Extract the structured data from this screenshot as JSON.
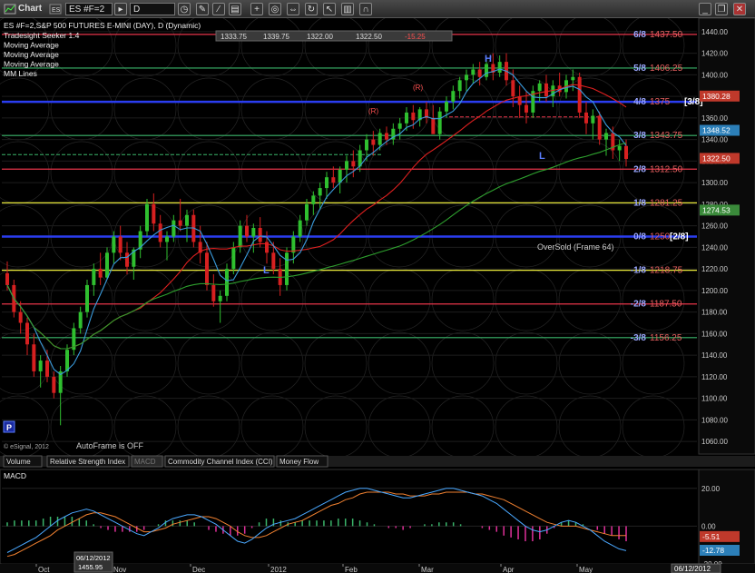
{
  "window": {
    "title": "Chart",
    "symbol": "ES #F=2",
    "interval": "D",
    "controls": [
      "minimize",
      "restore",
      "close"
    ]
  },
  "legend": {
    "line1": "ES #F=2,S&P 500 FUTURES E-MINI (DAY), D (Dynamic)",
    "indicators": [
      "Tradesight Seeker 1.4",
      "Moving Average",
      "Moving Average",
      "Moving Average",
      "MM Lines"
    ],
    "ohlc": [
      "1333.75",
      "1339.75",
      "1322.00",
      "1322.50",
      "-15.25"
    ]
  },
  "mm_lines": [
    {
      "label": "6/8",
      "value": "1437.50",
      "price": 1437.5,
      "color": "#e8344a"
    },
    {
      "label": "5/8",
      "value": "1406.25",
      "price": 1406.25,
      "color": "#3ab56a"
    },
    {
      "label": "4/8",
      "value": "1375",
      "price": 1375,
      "color": "#2a3df0"
    },
    {
      "label": "3/8",
      "value": "1343.75",
      "price": 1343.75,
      "color": "#3ab56a"
    },
    {
      "label": "2/8",
      "value": "1312.50",
      "price": 1312.5,
      "color": "#e8344a"
    },
    {
      "label": "1/8",
      "value": "1281.25",
      "price": 1281.25,
      "color": "#e8e83a"
    },
    {
      "label": "0/8",
      "value": "1250",
      "price": 1250,
      "color": "#2a3df0"
    },
    {
      "label": "-1/8",
      "value": "1218.75",
      "price": 1218.75,
      "color": "#e8e83a"
    },
    {
      "label": "-2/8",
      "value": "1187.50",
      "price": 1187.5,
      "color": "#e8344a"
    },
    {
      "label": "-3/8",
      "value": "1156.25",
      "price": 1156.25,
      "color": "#3ab56a"
    }
  ],
  "mm_tags": {
    "four_eighths": "[3/8]",
    "zero_eighths": "[2/8]"
  },
  "price_badges": [
    {
      "value": "1380.28",
      "price": 1380.28,
      "color": "#c0392b"
    },
    {
      "value": "1348.52",
      "price": 1348.52,
      "color": "#2c7fb8"
    },
    {
      "value": "1322.50",
      "price": 1322.5,
      "color": "#c0392b"
    },
    {
      "value": "1274.53",
      "price": 1274.53,
      "color": "#3a8a3a"
    }
  ],
  "annotations": {
    "oversold": "OverSold (Frame 64)",
    "autoframe": "AutoFrame is OFF",
    "copyright": "© eSignal, 2012",
    "H": "H",
    "L1": "L",
    "L2": "L",
    "R1": "(R)",
    "R2": "(R)",
    "P": "P"
  },
  "x_axis": {
    "ticks": [
      "Oct",
      "Nov",
      "Dec",
      "2012",
      "Feb",
      "Mar",
      "Apr",
      "May"
    ],
    "cursor_date": "06/12/2012",
    "cursor_price": "1455.95",
    "end_date": "06/12/2012"
  },
  "tabs": [
    "Volume",
    "Relative Strength Index",
    "MACD",
    "Commodity Channel Index (CCI)",
    "Money Flow"
  ],
  "macd_panel": {
    "title": "MACD",
    "badges": [
      {
        "value": "-5.51",
        "color": "#c0392b"
      },
      {
        "value": "-12.78",
        "color": "#2c7fb8"
      }
    ]
  },
  "chart_data": [
    {
      "type": "candlestick",
      "title": "ES #F=2,S&P 500 FUTURES E-MINI (DAY), D (Dynamic)",
      "y_axis": {
        "ylim": [
          1050,
          1450
        ],
        "ticks": [
          1060,
          1080,
          1100,
          1120,
          1140,
          1160,
          1180,
          1200,
          1220,
          1240,
          1260,
          1280,
          1300,
          1320,
          1340,
          1360,
          1380,
          1400,
          1420,
          1440
        ],
        "side": "right"
      },
      "x_axis": {
        "ticks": [
          "Oct",
          "Nov",
          "Dec",
          "2012",
          "Feb",
          "Mar",
          "Apr",
          "May"
        ]
      },
      "last_close": 1322.5,
      "ohlc": [
        [
          1216,
          1227,
          1200,
          1205
        ],
        [
          1205,
          1210,
          1175,
          1180
        ],
        [
          1180,
          1190,
          1160,
          1170
        ],
        [
          1170,
          1175,
          1140,
          1150
        ],
        [
          1150,
          1160,
          1120,
          1125
        ],
        [
          1125,
          1140,
          1110,
          1135
        ],
        [
          1135,
          1145,
          1115,
          1120
        ],
        [
          1120,
          1125,
          1100,
          1105
        ],
        [
          1105,
          1130,
          1075,
          1125
        ],
        [
          1125,
          1150,
          1120,
          1145
        ],
        [
          1145,
          1170,
          1140,
          1165
        ],
        [
          1165,
          1185,
          1160,
          1180
        ],
        [
          1180,
          1210,
          1175,
          1205
        ],
        [
          1205,
          1225,
          1195,
          1220
        ],
        [
          1220,
          1235,
          1205,
          1212
        ],
        [
          1212,
          1240,
          1210,
          1235
        ],
        [
          1235,
          1255,
          1225,
          1250
        ],
        [
          1250,
          1260,
          1228,
          1235
        ],
        [
          1235,
          1245,
          1215,
          1222
        ],
        [
          1222,
          1240,
          1210,
          1238
        ],
        [
          1238,
          1260,
          1230,
          1255
        ],
        [
          1255,
          1285,
          1250,
          1280
        ],
        [
          1280,
          1290,
          1255,
          1262
        ],
        [
          1262,
          1270,
          1240,
          1245
        ],
        [
          1245,
          1255,
          1228,
          1250
        ],
        [
          1250,
          1270,
          1245,
          1265
        ],
        [
          1265,
          1285,
          1255,
          1260
        ],
        [
          1260,
          1275,
          1245,
          1270
        ],
        [
          1270,
          1275,
          1240,
          1245
        ],
        [
          1245,
          1260,
          1225,
          1235
        ],
        [
          1235,
          1245,
          1200,
          1205
        ],
        [
          1205,
          1215,
          1185,
          1190
        ],
        [
          1190,
          1200,
          1170,
          1195
        ],
        [
          1195,
          1225,
          1190,
          1220
        ],
        [
          1220,
          1245,
          1215,
          1240
        ],
        [
          1240,
          1265,
          1235,
          1260
        ],
        [
          1260,
          1270,
          1245,
          1250
        ],
        [
          1250,
          1262,
          1235,
          1258
        ],
        [
          1258,
          1268,
          1240,
          1245
        ],
        [
          1245,
          1255,
          1225,
          1235
        ],
        [
          1235,
          1245,
          1215,
          1220
        ],
        [
          1220,
          1230,
          1195,
          1205
        ],
        [
          1205,
          1240,
          1200,
          1235
        ],
        [
          1235,
          1255,
          1225,
          1250
        ],
        [
          1250,
          1270,
          1245,
          1265
        ],
        [
          1265,
          1285,
          1260,
          1280
        ],
        [
          1280,
          1292,
          1270,
          1288
        ],
        [
          1288,
          1300,
          1275,
          1295
        ],
        [
          1295,
          1310,
          1285,
          1305
        ],
        [
          1305,
          1315,
          1295,
          1300
        ],
        [
          1300,
          1315,
          1290,
          1312
        ],
        [
          1312,
          1325,
          1300,
          1320
        ],
        [
          1320,
          1330,
          1305,
          1315
        ],
        [
          1315,
          1335,
          1310,
          1330
        ],
        [
          1330,
          1345,
          1320,
          1340
        ],
        [
          1340,
          1348,
          1325,
          1335
        ],
        [
          1335,
          1350,
          1330,
          1346
        ],
        [
          1346,
          1352,
          1335,
          1340
        ],
        [
          1340,
          1355,
          1335,
          1350
        ],
        [
          1350,
          1360,
          1340,
          1355
        ],
        [
          1355,
          1370,
          1348,
          1365
        ],
        [
          1365,
          1372,
          1350,
          1358
        ],
        [
          1358,
          1370,
          1352,
          1368
        ],
        [
          1368,
          1375,
          1355,
          1360
        ],
        [
          1360,
          1372,
          1350,
          1345
        ],
        [
          1345,
          1370,
          1340,
          1366
        ],
        [
          1366,
          1380,
          1360,
          1375
        ],
        [
          1375,
          1390,
          1368,
          1385
        ],
        [
          1385,
          1398,
          1378,
          1395
        ],
        [
          1395,
          1405,
          1385,
          1400
        ],
        [
          1400,
          1410,
          1392,
          1405
        ],
        [
          1405,
          1412,
          1390,
          1398
        ],
        [
          1398,
          1415,
          1395,
          1410
        ],
        [
          1410,
          1420,
          1395,
          1402
        ],
        [
          1402,
          1418,
          1398,
          1412
        ],
        [
          1412,
          1420,
          1390,
          1395
        ],
        [
          1395,
          1405,
          1370,
          1380
        ],
        [
          1380,
          1390,
          1360,
          1372
        ],
        [
          1372,
          1385,
          1355,
          1365
        ],
        [
          1365,
          1390,
          1360,
          1385
        ],
        [
          1385,
          1395,
          1375,
          1392
        ],
        [
          1392,
          1400,
          1375,
          1380
        ],
        [
          1380,
          1395,
          1370,
          1390
        ],
        [
          1390,
          1402,
          1380,
          1384
        ],
        [
          1384,
          1400,
          1378,
          1395
        ],
        [
          1395,
          1405,
          1385,
          1398
        ],
        [
          1398,
          1402,
          1360,
          1365
        ],
        [
          1365,
          1375,
          1345,
          1355
        ],
        [
          1355,
          1368,
          1340,
          1362
        ],
        [
          1362,
          1366,
          1335,
          1340
        ],
        [
          1340,
          1350,
          1325,
          1346
        ],
        [
          1346,
          1352,
          1322,
          1330
        ],
        [
          1330,
          1340,
          1320,
          1334
        ],
        [
          1334,
          1340,
          1315,
          1322
        ]
      ],
      "moving_averages": [
        {
          "label": "Moving Average",
          "color": "#e02020"
        },
        {
          "label": "Moving Average",
          "color": "#3a9bdc"
        },
        {
          "label": "Moving Average",
          "color": "#2ea02e"
        }
      ]
    },
    {
      "type": "bar+line",
      "title": "MACD",
      "y_axis": {
        "ylim": [
          -20,
          30
        ],
        "ticks": [
          20,
          0,
          -20
        ]
      },
      "macd": [
        -14,
        -12,
        -10,
        -8,
        -6,
        -3,
        0,
        3,
        5,
        7,
        8,
        9,
        8,
        6,
        4,
        2,
        0,
        -2,
        -4,
        -5,
        -3,
        -1,
        2,
        4,
        5,
        6,
        6,
        5,
        3,
        1,
        -2,
        -5,
        -8,
        -9,
        -7,
        -4,
        -1,
        1,
        2,
        3,
        4,
        6,
        8,
        10,
        12,
        14,
        16,
        18,
        19,
        20,
        20,
        19,
        18,
        17,
        16,
        15,
        15,
        16,
        17,
        18,
        19,
        20,
        20,
        19,
        18,
        17,
        16,
        14,
        12,
        9,
        6,
        3,
        0,
        -2,
        -3,
        -2,
        0,
        2,
        3,
        2,
        0,
        -2,
        -5,
        -8,
        -10,
        -12,
        -13
      ],
      "signal": [
        -16,
        -15,
        -13,
        -11,
        -9,
        -7,
        -5,
        -2,
        0,
        2,
        4,
        6,
        7,
        7,
        6,
        5,
        3,
        1,
        -1,
        -3,
        -3,
        -2,
        -1,
        1,
        2,
        3,
        4,
        5,
        5,
        4,
        2,
        0,
        -3,
        -5,
        -6,
        -6,
        -5,
        -3,
        -1,
        1,
        2,
        3,
        5,
        7,
        9,
        11,
        12,
        14,
        15,
        17,
        18,
        18,
        18,
        18,
        17,
        17,
        16,
        16,
        16,
        17,
        17,
        18,
        18,
        18,
        18,
        17,
        17,
        16,
        15,
        14,
        12,
        10,
        8,
        6,
        4,
        2,
        1,
        0,
        0,
        0,
        -1,
        -2,
        -3,
        -4,
        -5,
        -5,
        -5
      ],
      "hist_color_pos": "#3ab56a",
      "hist_color_neg": "#e0309a",
      "macd_color": "#4aa8ff",
      "signal_color": "#f08030"
    }
  ]
}
